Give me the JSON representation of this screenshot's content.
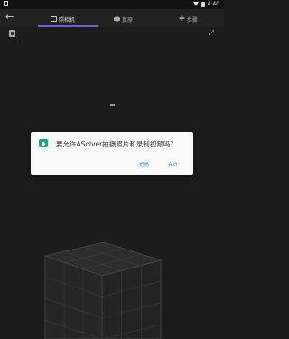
{
  "status_bar": {
    "time": "4:40",
    "icons": [
      "notification-square-icon",
      "wifi-icon",
      "battery-icon"
    ]
  },
  "toolbar": {
    "back_icon": "arrow-left-icon",
    "tabs": [
      {
        "label": "照相机",
        "icon": "camera-icon",
        "active": true
      },
      {
        "label": "复原",
        "icon": "cube-icon",
        "active": false
      },
      {
        "label": "步骤",
        "icon": "steps-icon",
        "active": false
      }
    ],
    "accent_color": "#6c63d0"
  },
  "overlay_icons": {
    "left": "sd-card-icon",
    "right": "shuffle-icon"
  },
  "permission_dialog": {
    "message": "要允许ASolver拍摄照片和录制视频吗?",
    "deny_label": "拒绝",
    "allow_label": "允许",
    "icon": "camera-icon",
    "icon_color": "#1aa38f",
    "button_color": "#2a7ec8"
  }
}
